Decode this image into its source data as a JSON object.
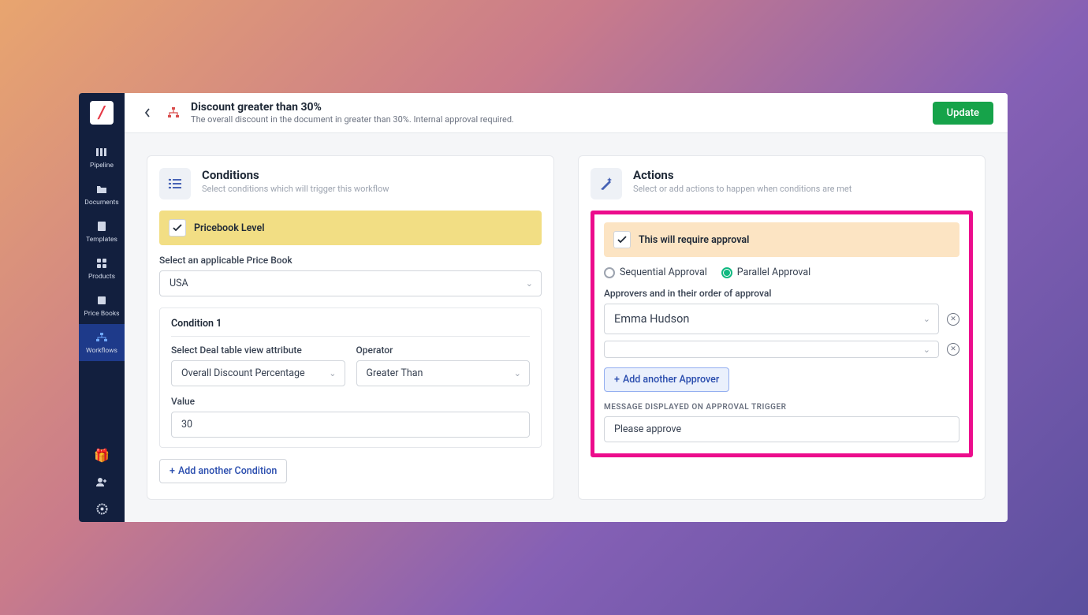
{
  "sidebar": {
    "items": [
      {
        "label": "Pipeline"
      },
      {
        "label": "Documents"
      },
      {
        "label": "Templates"
      },
      {
        "label": "Products"
      },
      {
        "label": "Price Books"
      },
      {
        "label": "Workflows"
      }
    ]
  },
  "header": {
    "title": "Discount greater than 30%",
    "subtitle": "The overall discount in the document in greater than 30%. Internal approval required.",
    "update_label": "Update"
  },
  "conditions": {
    "title": "Conditions",
    "subtitle": "Select conditions which will trigger this workflow",
    "bar_label": "Pricebook Level",
    "pricebook_label": "Select an applicable Price Book",
    "pricebook_value": "USA",
    "cond1_title": "Condition 1",
    "attr_label": "Select Deal table view attribute",
    "attr_value": "Overall Discount Percentage",
    "op_label": "Operator",
    "op_value": "Greater Than",
    "value_label": "Value",
    "value_value": "30",
    "add_label": "Add another Condition"
  },
  "actions": {
    "title": "Actions",
    "subtitle": "Select or add actions to happen when conditions are met",
    "bar_label": "This will require approval",
    "radio_seq": "Sequential Approval",
    "radio_par": "Parallel Approval",
    "approvers_label": "Approvers and in their order of approval",
    "approver1": "Emma Hudson",
    "approver2": "",
    "add_label": "Add another Approver",
    "msg_label": "MESSAGE DISPLAYED ON APPROVAL TRIGGER",
    "msg_value": "Please approve"
  }
}
